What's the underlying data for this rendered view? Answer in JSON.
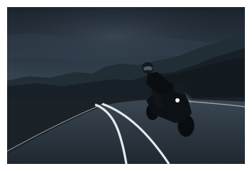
{
  "image": {
    "alt": "",
    "colors": {
      "sky_top": "#1b232d",
      "sky_mid": "#2c3946",
      "sky_horizon": "#3f4d5a",
      "hills_far": "#1e2a30",
      "hills_near": "#141c20",
      "road": "#2a343e",
      "road_edge": "#1c242c",
      "lane_line": "#dfe6ea",
      "bike": "#0c0f12",
      "headlight": "#f4f6f2"
    },
    "icons": {
      "subject": "motorcyclist-icon"
    }
  }
}
